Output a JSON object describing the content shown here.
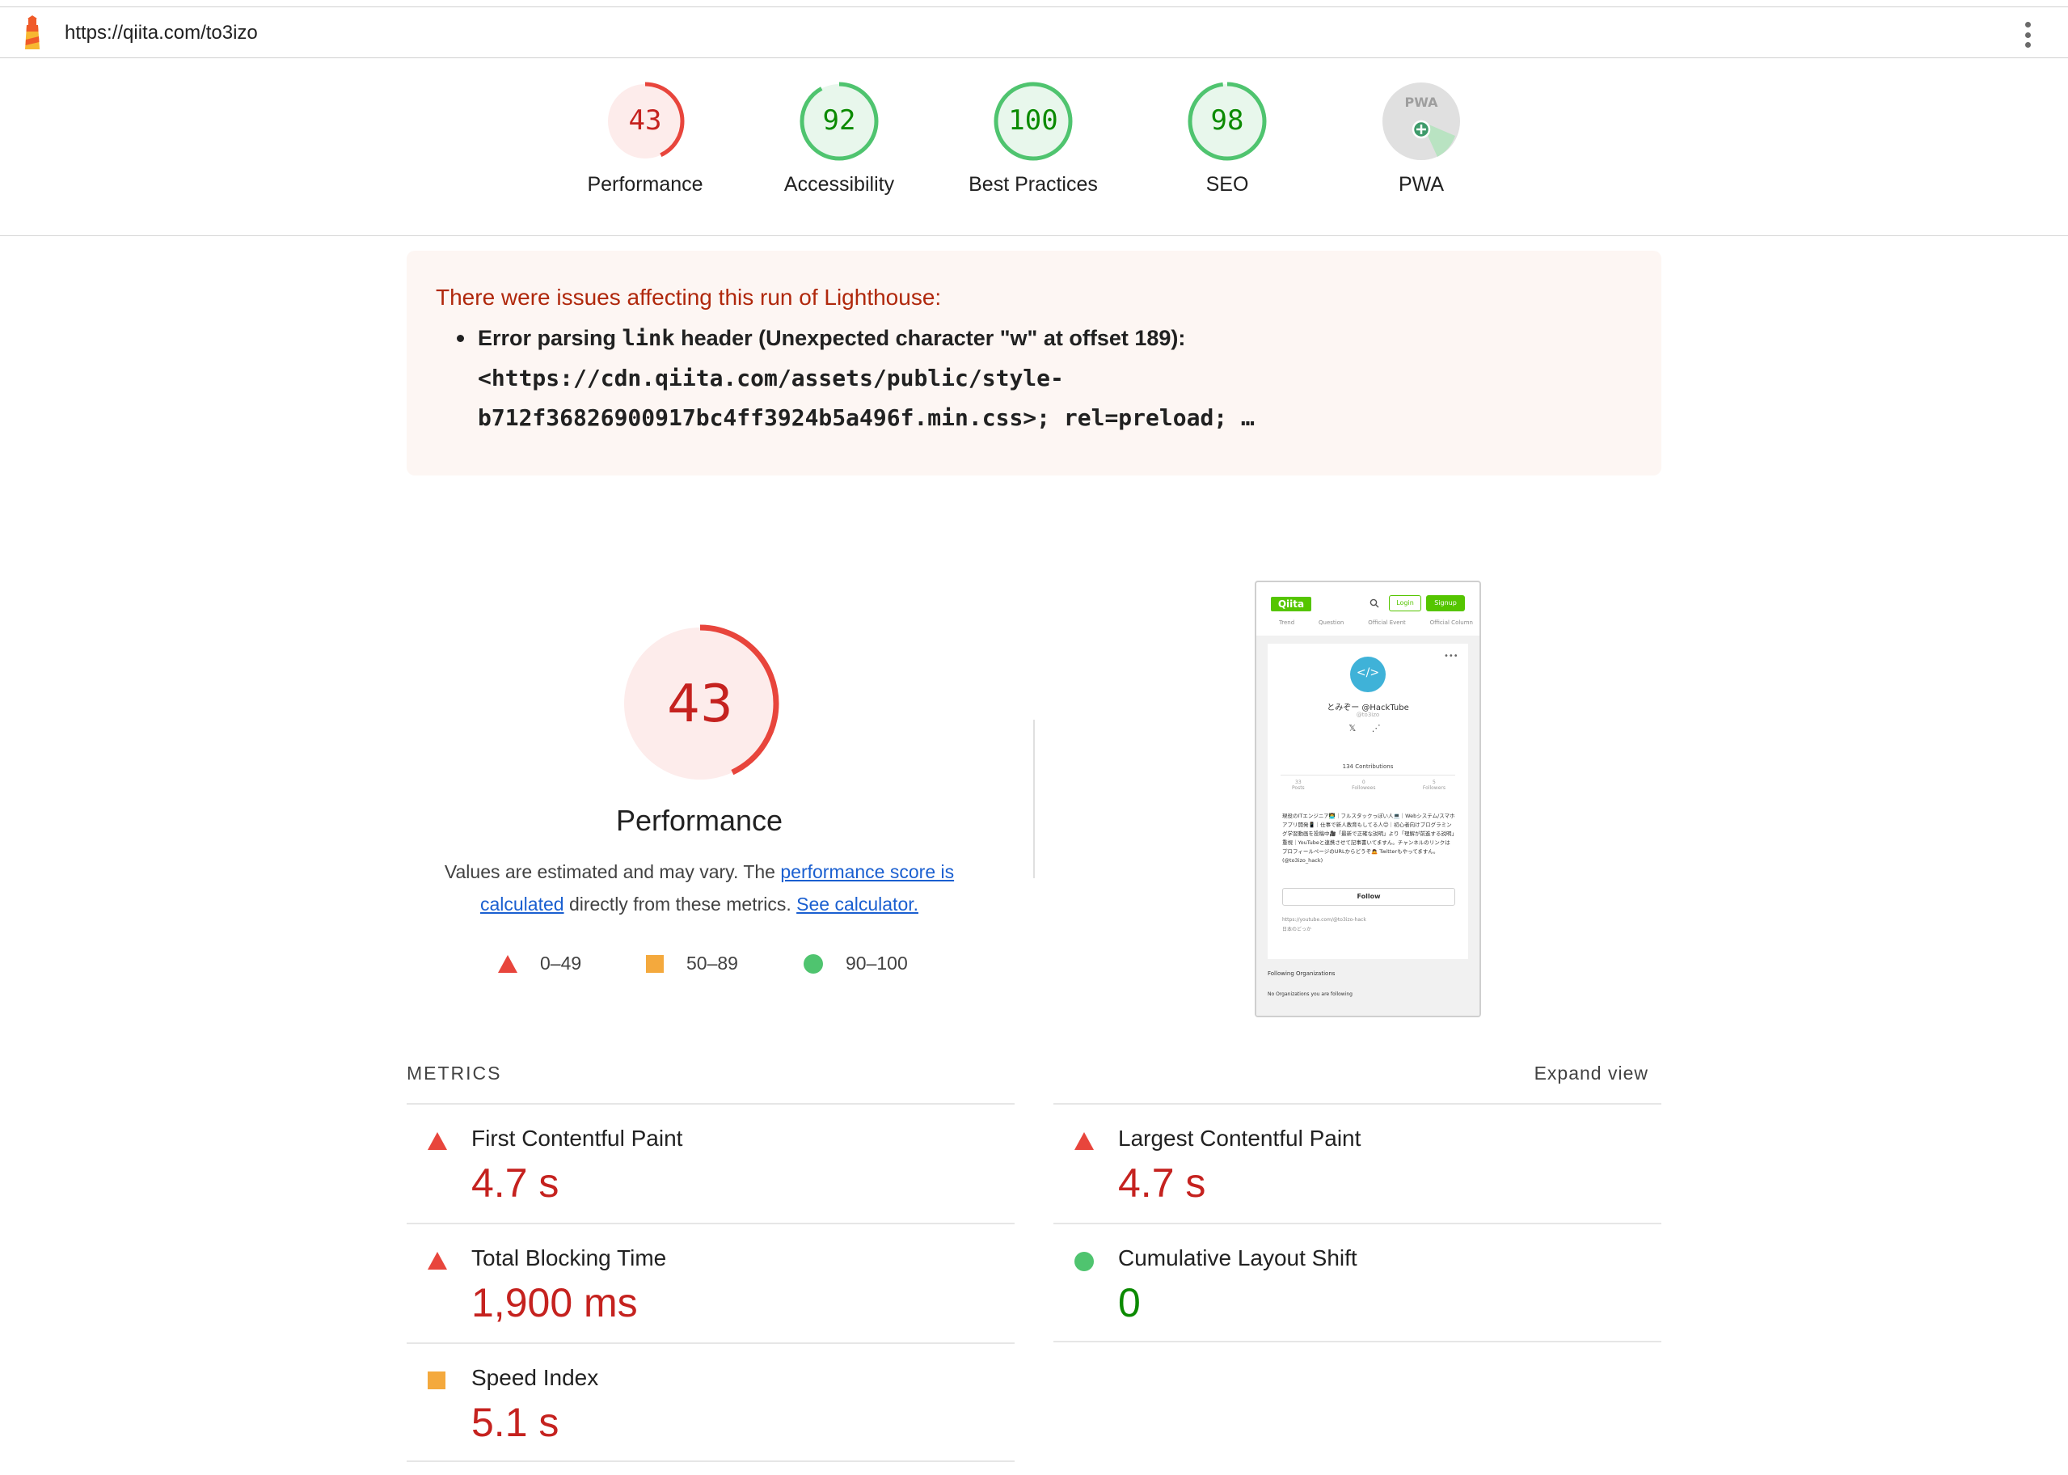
{
  "topbar": {
    "url": "https://qiita.com/to3izo"
  },
  "colors": {
    "fail": "#e8453c",
    "average": "#f4a93d",
    "pass": "#4fc46f",
    "fail_text": "#c5221f",
    "pass_text": "#0b8a00"
  },
  "gauges": [
    {
      "label": "Performance",
      "score": 43,
      "status": "fail"
    },
    {
      "label": "Accessibility",
      "score": 92,
      "status": "pass"
    },
    {
      "label": "Best Practices",
      "score": 100,
      "status": "pass"
    },
    {
      "label": "SEO",
      "score": 98,
      "status": "pass"
    },
    {
      "label": "PWA",
      "score": null,
      "status": "na",
      "badge_text": "PWA"
    }
  ],
  "warning": {
    "title": "There were issues affecting this run of Lighthouse:",
    "item_prefix": "Error parsing ",
    "item_code": "link",
    "item_suffix": " header (Unexpected character \"w\" at offset 189):",
    "code_line1": "<https://cdn.qiita.com/assets/public/style-",
    "code_line2": "b712f36826900917bc4ff3924b5a496f.min.css>; rel=preload; …"
  },
  "performance": {
    "score": "43",
    "title": "Performance",
    "desc_prefix": "Values are estimated and may vary. The ",
    "desc_link1": "performance score is calculated",
    "desc_middle": " directly from these metrics. ",
    "desc_link2": "See calculator.",
    "legend": [
      {
        "range": "0–49",
        "icon": "triangle-icon"
      },
      {
        "range": "50–89",
        "icon": "square-icon"
      },
      {
        "range": "90–100",
        "icon": "circle-icon"
      }
    ]
  },
  "thumbnail": {
    "logo": "Qiita",
    "login": "Login",
    "signup": "Signup",
    "nav": [
      "Trend",
      "Question",
      "Official Event",
      "Official Column"
    ],
    "avatar": "</>",
    "name": "とみぞー @HackTube",
    "handle": "@to3izo",
    "social": "𝕏 ⋰",
    "contributions": "134 Contributions",
    "stats": [
      {
        "value": "33",
        "label": "Posts"
      },
      {
        "value": "0",
        "label": "Followees"
      },
      {
        "value": "5",
        "label": "Followers"
      }
    ],
    "bio": "現役のITエンジニア👨‍💻｜フルスタックっぽい人💻｜Webシステム/スマホアプリ開発📱｜仕事で新人教育もしてる人😊｜初心者向けプログラミング学習動画を投稿中🎥「最新で正確な説明」より「理解が前進する説明」重視｜YouTubeと連携させて記事書いてますん。チャンネルのリンクはプロフィールページのURLからどうぞ🙇 Twitterもやってますん。(@to3izo_hack)",
    "follow": "Follow",
    "link1": "https://youtube.com/@to3izo-hack",
    "link2": "日本のどっか",
    "org_title": "Following Organizations",
    "org_none": "No Organizations you are following"
  },
  "metrics": {
    "header": "METRICS",
    "expand": "Expand view",
    "items": [
      {
        "name": "First Contentful Paint",
        "value": "4.7 s",
        "status": "fail"
      },
      {
        "name": "Largest Contentful Paint",
        "value": "4.7 s",
        "status": "fail"
      },
      {
        "name": "Total Blocking Time",
        "value": "1,900 ms",
        "status": "fail"
      },
      {
        "name": "Cumulative Layout Shift",
        "value": "0",
        "status": "pass"
      },
      {
        "name": "Speed Index",
        "value": "5.1 s",
        "status": "average"
      }
    ]
  }
}
